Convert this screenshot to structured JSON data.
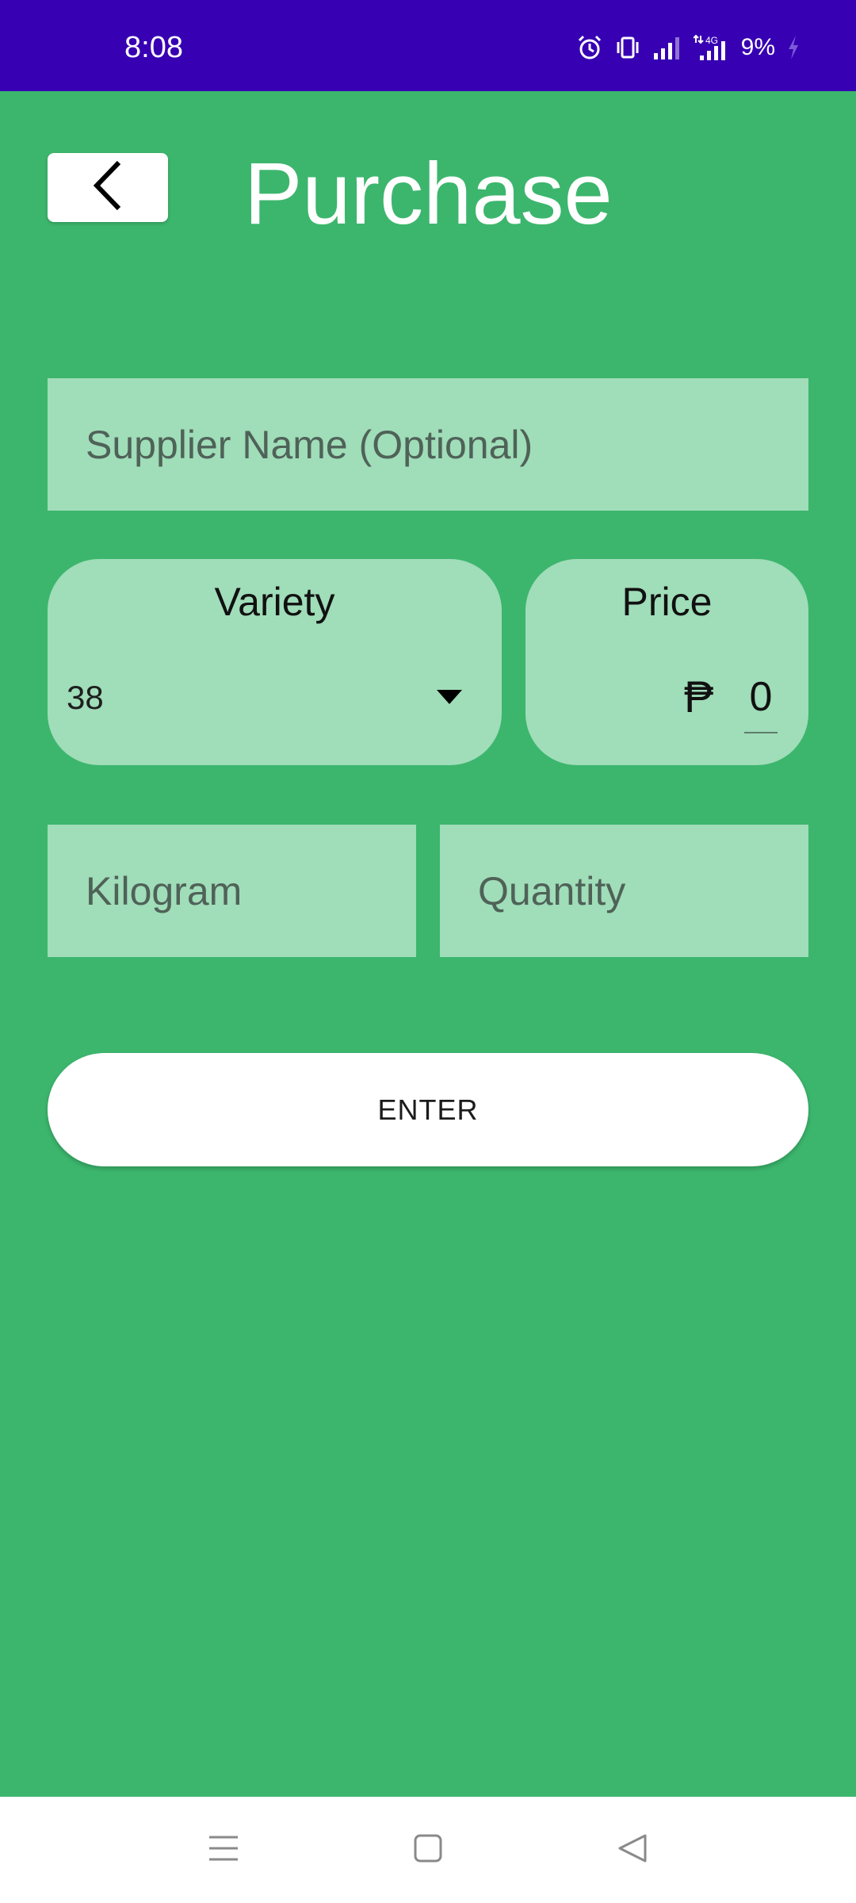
{
  "status_bar": {
    "time": "8:08",
    "network": "4G",
    "battery": "9%",
    "icons": [
      "alarm-icon",
      "vibrate-icon",
      "signal-icon",
      "data-signal-icon",
      "charging-icon"
    ]
  },
  "header": {
    "title": "Purchase",
    "back_icon": "chevron-left-icon"
  },
  "form": {
    "supplier_placeholder": "Supplier Name (Optional)",
    "variety": {
      "label": "Variety",
      "selected": "38"
    },
    "price": {
      "label": "Price",
      "currency": "₱",
      "value": "0"
    },
    "kilogram_placeholder": "Kilogram",
    "quantity_placeholder": "Quantity",
    "enter_label": "ENTER"
  },
  "navigation": {
    "items": [
      "menu-icon",
      "home-icon",
      "back-icon"
    ]
  },
  "colors": {
    "status_bar": "#3700b3",
    "background": "#3cb66d",
    "field": "#a0ddb9",
    "button": "#ffffff"
  }
}
